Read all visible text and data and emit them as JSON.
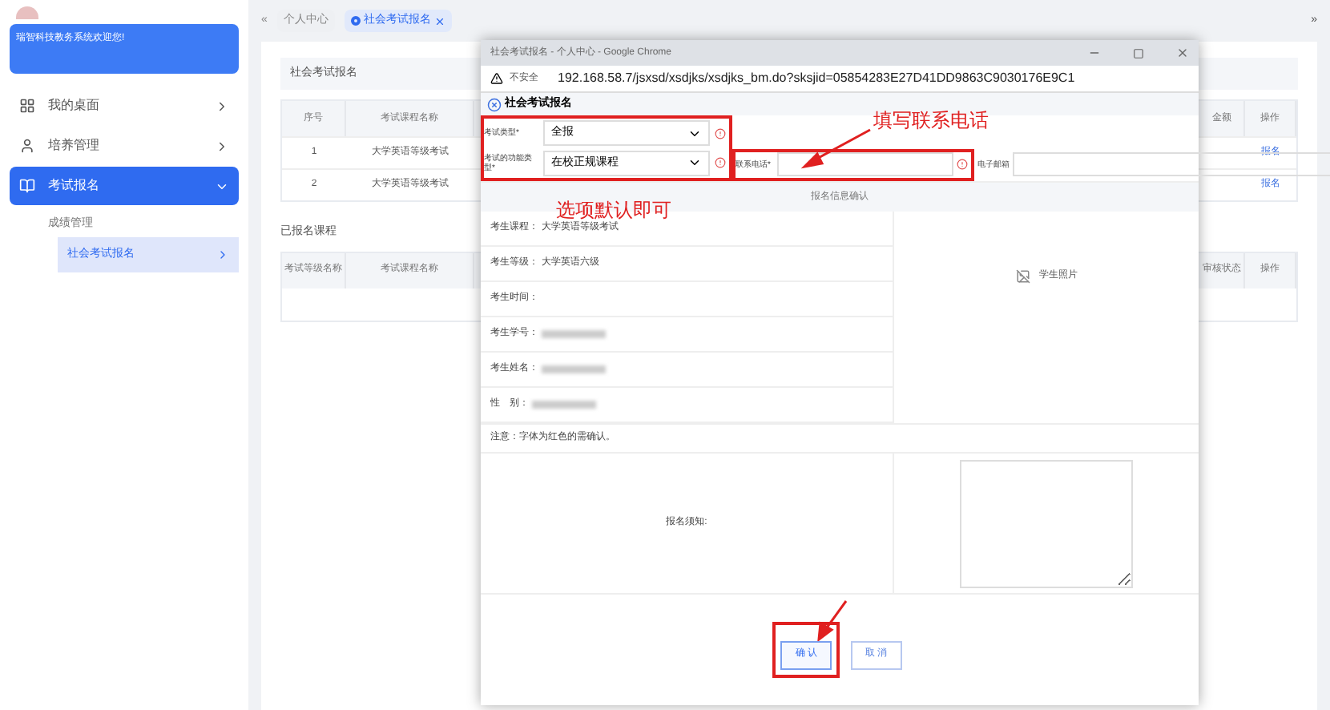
{
  "sidebar": {
    "welcome": "瑞智科技教务系统欢迎您!",
    "items": [
      {
        "label": "我的桌面",
        "selected": false,
        "expanded": false
      },
      {
        "label": "培养管理",
        "selected": false,
        "expanded": false
      },
      {
        "label": "考试报名",
        "selected": true,
        "expanded": true,
        "children": [
          {
            "label": "成绩管理",
            "selected": false,
            "children": [
              {
                "label": "社会考试报名",
                "selected": true
              }
            ]
          }
        ]
      }
    ]
  },
  "tabs": {
    "prev": "«",
    "next": "»",
    "items": [
      {
        "label": "个人中心",
        "selected": false,
        "closable": false
      },
      {
        "label": "社会考试报名",
        "selected": true,
        "closable": true
      }
    ]
  },
  "exam_panel": {
    "title": "社会考试报名",
    "columns": [
      "序号",
      "考试课程名称",
      "金额",
      "操作"
    ],
    "rows": [
      {
        "cells": [
          "1",
          "大学英语等级考试"
        ],
        "action": "报名"
      },
      {
        "cells": [
          "2",
          "大学英语等级考试"
        ],
        "action": "报名"
      }
    ]
  },
  "registered_panel": {
    "title": "已报名课程",
    "columns": [
      "考试等级名称",
      "考试课程名称",
      "审核状态",
      "操作"
    ]
  },
  "popup": {
    "window_title": "社会考试报名 - 个人中心 - Google Chrome",
    "security": "不安全",
    "url": "192.168.58.7/jsxsd/xsdjks/xsdjks_bm.do?sksjid=05854283E27D41DD9863C9030176E9C1",
    "dialog_title": "社会考试报名",
    "selects": [
      {
        "label": "考试类型*",
        "value": "全报"
      },
      {
        "label": "考试的功能类型*",
        "value": "在校正规课程"
      }
    ],
    "phone": {
      "label": "联系电话*"
    },
    "email": {
      "label": "电子邮箱"
    },
    "section_title": "报名信息确认",
    "info_rows": [
      {
        "label": "考生课程：",
        "value": "大学英语等级考试",
        "redacted": false
      },
      {
        "label": "考生等级：",
        "value": "大学英语六级",
        "redacted": false
      },
      {
        "label": "考生时间：",
        "value": "",
        "redacted": false
      },
      {
        "label": "考生学号：",
        "value": "",
        "redacted": true
      },
      {
        "label": "考生姓名：",
        "value": "",
        "redacted": true
      },
      {
        "label": "性　别：",
        "value": "",
        "redacted": true
      }
    ],
    "photo_alt": "学生照片",
    "note": "注意：字体为红色的需确认。",
    "notice_label": "报名须知:",
    "buttons": [
      {
        "label": "确 认",
        "kind": "primary"
      },
      {
        "label": "取 消",
        "kind": "secondary"
      }
    ]
  },
  "annotations": [
    {
      "text": "填写联系电话"
    },
    {
      "text": "选项默认即可"
    }
  ]
}
